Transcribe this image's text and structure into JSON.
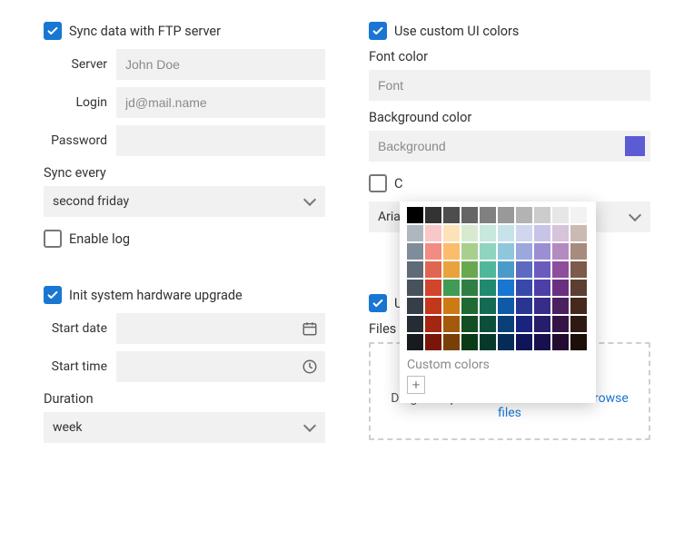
{
  "left": {
    "sync": {
      "checkbox_label": "Sync data with FTP server",
      "server_label": "Server",
      "server_placeholder": "John Doe",
      "login_label": "Login",
      "login_placeholder": "jd@mail.name",
      "password_label": "Password",
      "sync_every_label": "Sync every",
      "sync_every_value": "second friday",
      "enable_log_label": "Enable log"
    },
    "init": {
      "checkbox_label": "Init system hardware upgrade",
      "start_date_label": "Start date",
      "start_time_label": "Start time",
      "duration_label": "Duration",
      "duration_value": "week"
    }
  },
  "right": {
    "colors_checkbox_label": "Use custom UI colors",
    "font_color_label": "Font color",
    "font_color_placeholder": "Font",
    "background_color_label": "Background color",
    "background_color_placeholder": "Background",
    "background_swatch": "#5b5bd6",
    "custom_font_checkbox_partial": "C",
    "custom_font_value_partial": "Arial",
    "upload_checkbox_partial": "Up",
    "files_label": "Files",
    "upload_text_prefix": "Drag & drop files or folders here or ",
    "upload_link": "browse files"
  },
  "picker": {
    "custom_label": "Custom colors",
    "rows": [
      [
        "#000000",
        "#333333",
        "#4d4d4d",
        "#666666",
        "#808080",
        "#999999",
        "#b3b3b3",
        "#cccccc",
        "#e6e6e6",
        "#f2f2f2"
      ],
      [
        "#aeb7bf",
        "#f8c8c8",
        "#fde2b8",
        "#d7ead0",
        "#c7e8dc",
        "#c7e3ea",
        "#cfd6ee",
        "#c8c4e8",
        "#d6c4da",
        "#cbbab2"
      ],
      [
        "#7f8c99",
        "#f28b82",
        "#fbbc6c",
        "#a8d08d",
        "#8fd4c1",
        "#8ec7db",
        "#9aa8dc",
        "#9a8fd2",
        "#b48bc1",
        "#a78b7d"
      ],
      [
        "#5f6b78",
        "#e06651",
        "#e8a33d",
        "#6aa84f",
        "#4fb79a",
        "#4a9bc7",
        "#5c6bc0",
        "#6b5bbf",
        "#8e4e9c",
        "#7d5a49"
      ],
      [
        "#47525d",
        "#d0452c",
        "#3f9b55",
        "#2f7f44",
        "#1f8a70",
        "#1976d2",
        "#3949ab",
        "#4d3ea8",
        "#6a2f80",
        "#5c3f31"
      ],
      [
        "#363f48",
        "#c3371a",
        "#cc7a14",
        "#1f6a32",
        "#126b52",
        "#0f5aa8",
        "#283593",
        "#382c8a",
        "#4c1f5e",
        "#45291d"
      ],
      [
        "#262c33",
        "#a32610",
        "#a35a0b",
        "#124f22",
        "#0b4f3b",
        "#0a3f78",
        "#1a237e",
        "#261d6b",
        "#351445",
        "#2f1a12"
      ],
      [
        "#171b20",
        "#7a1608",
        "#7a3f06",
        "#0a3a16",
        "#053a2b",
        "#052c58",
        "#101559",
        "#180f4e",
        "#230b30",
        "#1e0e08"
      ]
    ]
  }
}
